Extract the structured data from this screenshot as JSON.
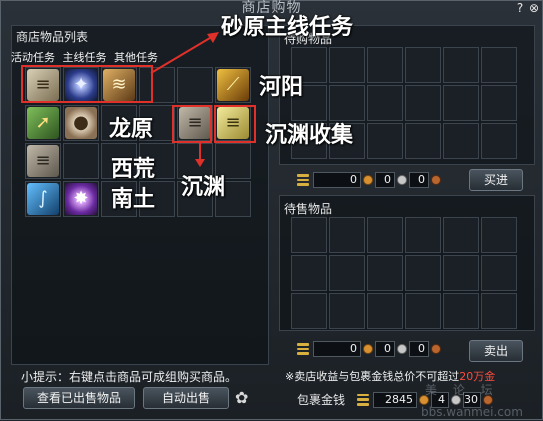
{
  "window": {
    "title": "商店购物",
    "help_icon": "?",
    "close_icon": "⊗"
  },
  "left_panel": {
    "header": "商店物品列表",
    "tabs": [
      "活动任务",
      "主线任务",
      "其他任务"
    ],
    "items": [
      {
        "icon": "scroll",
        "glyph": "≡"
      },
      {
        "icon": "blue-orb",
        "glyph": "✦"
      },
      {
        "icon": "claw",
        "glyph": "≋"
      },
      {
        "icon": "gold-feather",
        "glyph": "⟋"
      },
      {
        "icon": "arrow-up",
        "glyph": "➚"
      },
      {
        "icon": "bag",
        "glyph": "●"
      },
      {
        "icon": "paper",
        "glyph": "≡"
      },
      {
        "icon": "note",
        "glyph": "≡"
      },
      {
        "icon": "scroll-open",
        "glyph": "≡"
      },
      {
        "icon": "blue-ribbon",
        "glyph": "∫"
      },
      {
        "icon": "purple-star",
        "glyph": "✸"
      }
    ],
    "hint": "小提示：右键点击商品可成组购买商品。",
    "view_sold_button": "查看已出售物品",
    "auto_sell_button": "自动出售",
    "settings_icon": "✿"
  },
  "buy_panel": {
    "header": "待购物品",
    "gold": "0",
    "silver": "0",
    "copper": "0",
    "button": "买进"
  },
  "sell_panel": {
    "header": "待售物品",
    "gold": "0",
    "silver": "0",
    "copper": "0",
    "button": "卖出"
  },
  "warning": {
    "text": "※卖店收益与包裹金钱总价不可超过",
    "limit": "20万金"
  },
  "wallet": {
    "label": "包裹金钱",
    "gold": "2845",
    "silver": "4",
    "copper": "30"
  },
  "annotations": {
    "main_quest": "砂原主线任务",
    "heyang": "河阳",
    "longyuan": "龙原",
    "chenyuan_collect": "沉渊收集",
    "xihuang": "西荒",
    "nantu": "南土",
    "chenyuan": "沉渊"
  },
  "watermark": "bbs.wanmei.com",
  "watermark_cn": "美 论 坛",
  "colors": {
    "annotation_red": "#e0302a",
    "warning_red": "#ff4a3a",
    "coin_gold": "#d89030",
    "coin_silver": "#c8c8c8",
    "coin_copper": "#b8662e"
  }
}
